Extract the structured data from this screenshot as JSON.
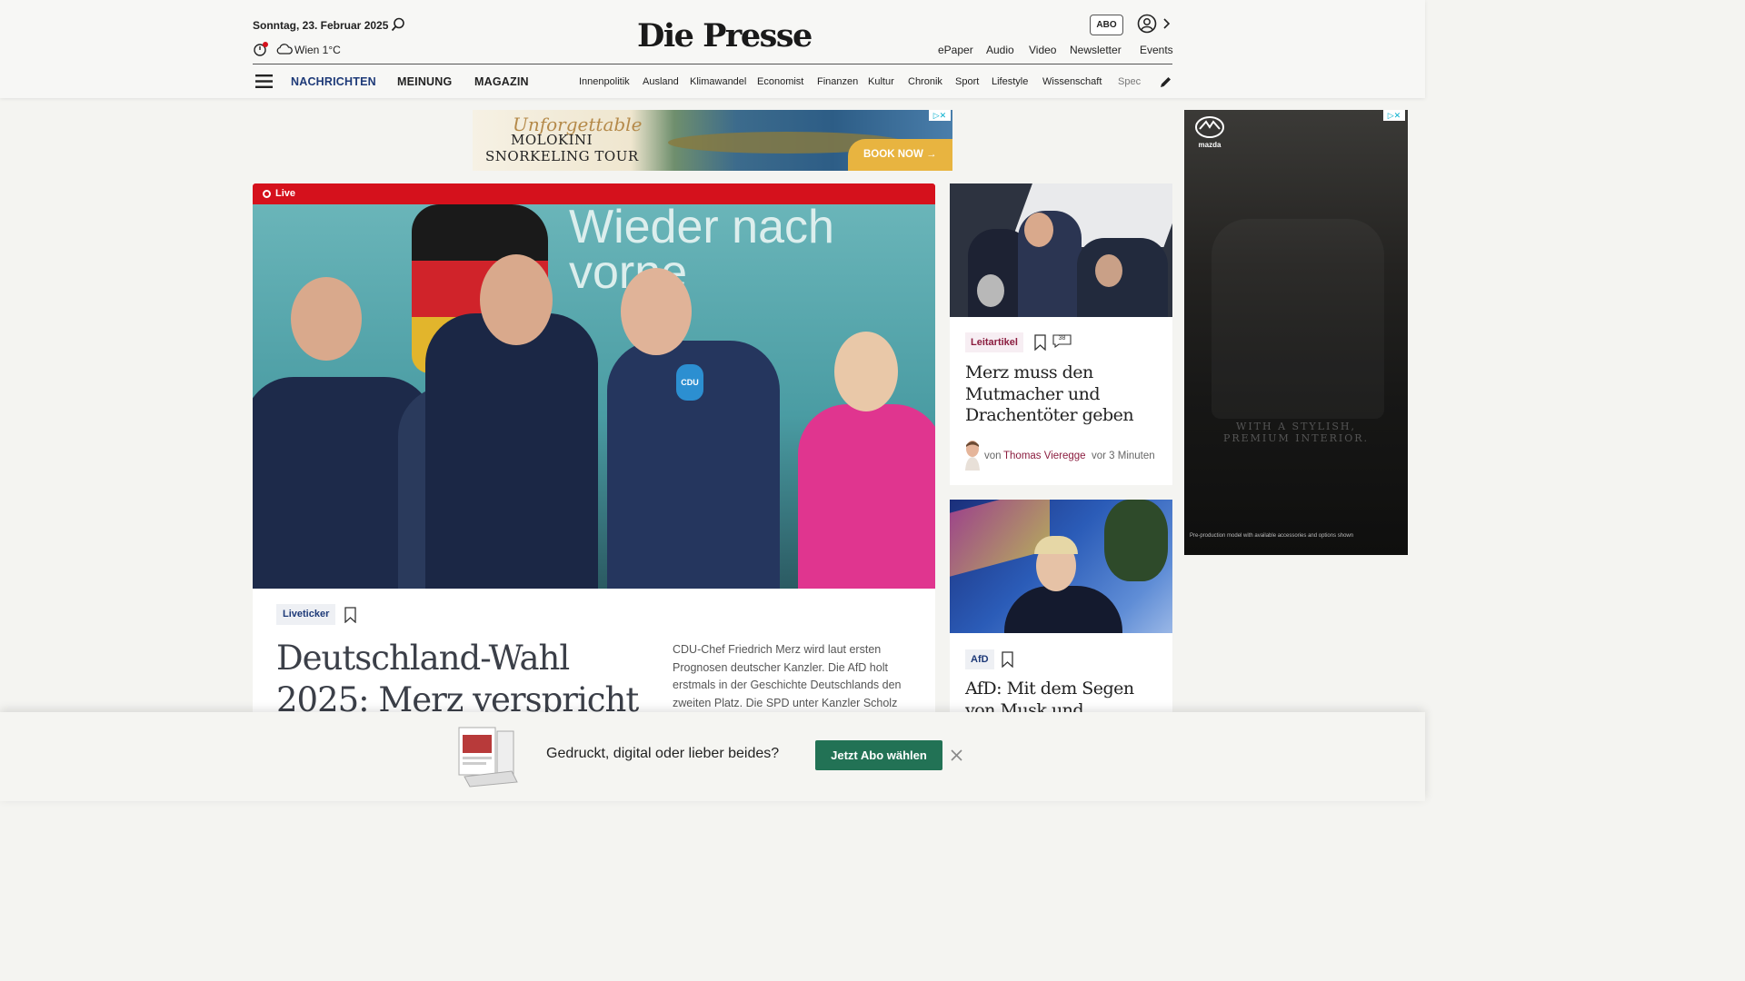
{
  "header": {
    "date": "Sonntag, 23. Februar 2025",
    "weather": "Wien 1°C",
    "logo": "Die Presse",
    "abo_label": "ABO",
    "top_links": [
      "ePaper",
      "Audio",
      "Video",
      "Newsletter",
      "Events"
    ],
    "main_nav": [
      "NACHRICHTEN",
      "MEINUNG",
      "MAGAZIN"
    ],
    "sub_nav": [
      "Innenpolitik",
      "Ausland",
      "Klimawandel",
      "Economist",
      "Finanzen",
      "Kultur",
      "Chronik",
      "Sport",
      "Lifestyle",
      "Wissenschaft",
      "Spec"
    ]
  },
  "ad_banner": {
    "script": "Unforgettable",
    "title_line1": "MOLOKINI",
    "title_line2": "SNORKELING TOUR",
    "cta": "BOOK NOW"
  },
  "ad_side": {
    "brand": "mazda",
    "text": "WITH A STYLISH, PREMIUM INTERIOR.",
    "fine_print": "Pre-production model with available accessories and options shown"
  },
  "main_story": {
    "live_label": "Live",
    "photo_text": "Wieder nach vorne",
    "mic_label": "CDU",
    "tag": "Liveticker",
    "headline": "Deutschland-Wahl 2025: Merz verspricht rasche",
    "teaser": "CDU-Chef Friedrich Merz wird laut ersten Prognosen deutscher Kanzler. Die AfD holt erstmals in der Geschichte Deutschlands den zweiten Platz. Die SPD unter Kanzler Scholz"
  },
  "card1": {
    "tag": "Leitartikel",
    "comment_count": "38",
    "title": "Merz muss den Mutmacher und Drachentöter geben",
    "author_prefix": "von",
    "author": "Thomas Vieregge",
    "time": "vor 3 Minuten"
  },
  "card2": {
    "tag": "AfD",
    "title": "AfD: Mit dem Segen von Musk und"
  },
  "offer": {
    "text": "Gedruckt, digital oder lieber beides?",
    "button": "Jetzt Abo wählen"
  },
  "colors": {
    "brand_blue": "#1e3a78",
    "live_red": "#d5111c",
    "offer_green": "#227255",
    "leitartikel": "#8b1d3f"
  }
}
